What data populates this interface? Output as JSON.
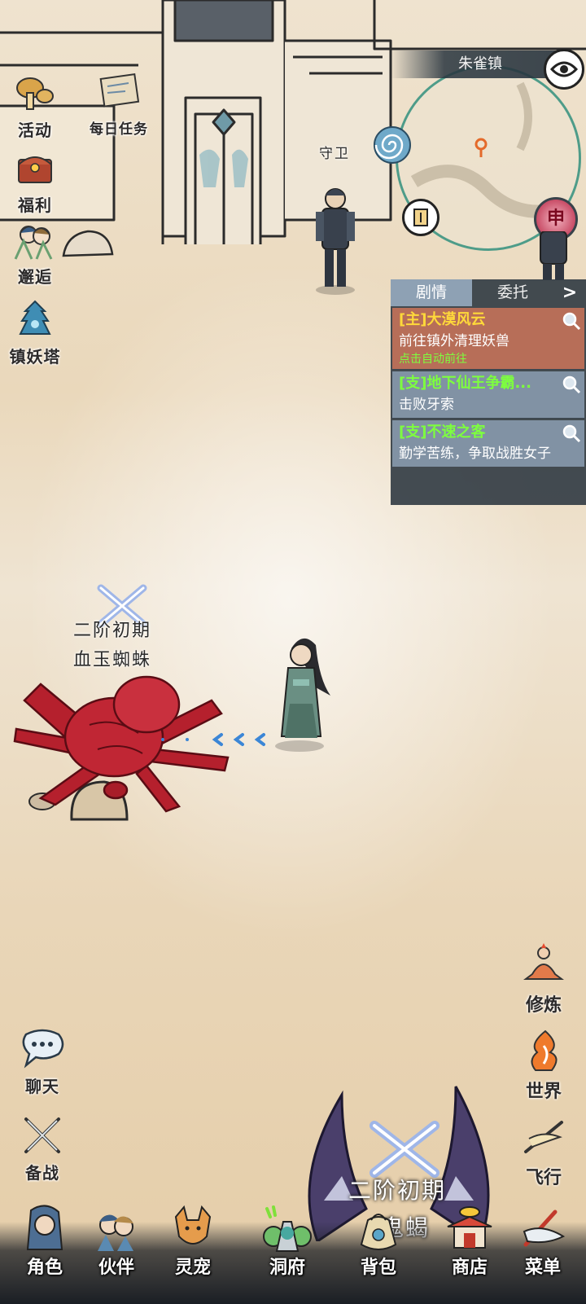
{
  "minimap": {
    "location": "朱雀镇",
    "shen_label": "申"
  },
  "npc_guard": {
    "name": "守卫"
  },
  "left_menu": [
    {
      "id": "activity",
      "label": "活动"
    },
    {
      "id": "daily",
      "label": "每日任务"
    },
    {
      "id": "welfare",
      "label": "福利"
    },
    {
      "id": "encounter",
      "label": "邂逅"
    },
    {
      "id": "tower",
      "label": "镇妖塔"
    }
  ],
  "quest_panel": {
    "tabs": [
      "剧情",
      "委托"
    ],
    "quests": [
      {
        "title": "[主]大漠风云",
        "desc": "前往镇外清理妖兽",
        "hint": "点击自动前往",
        "color": "#ffd93a"
      },
      {
        "title": "[支]地下仙王争霸...",
        "desc": "击败牙索",
        "hint": "",
        "color": "#7dff3e"
      },
      {
        "title": "[支]不速之客",
        "desc": "勤学苦练，争取战胜女子",
        "hint": "",
        "color": "#7dff3e"
      }
    ]
  },
  "monster1": {
    "rank": "二阶初期",
    "name": "血玉蜘蛛"
  },
  "monster2": {
    "rank": "二阶初期",
    "name": "鬼蝎"
  },
  "right_menu": [
    {
      "id": "cultivate",
      "label": "修炼"
    },
    {
      "id": "world",
      "label": "世界"
    },
    {
      "id": "fly",
      "label": "飞行"
    }
  ],
  "left_bottom": [
    {
      "id": "chat",
      "label": "聊天"
    },
    {
      "id": "battle",
      "label": "备战"
    }
  ],
  "bottom_nav": [
    {
      "id": "role",
      "label": "角色"
    },
    {
      "id": "partner",
      "label": "伙伴"
    },
    {
      "id": "pet",
      "label": "灵宠"
    },
    {
      "id": "cave",
      "label": "洞府"
    },
    {
      "id": "bag",
      "label": "背包"
    },
    {
      "id": "shop",
      "label": "商店"
    },
    {
      "id": "menu",
      "label": "菜单"
    }
  ]
}
